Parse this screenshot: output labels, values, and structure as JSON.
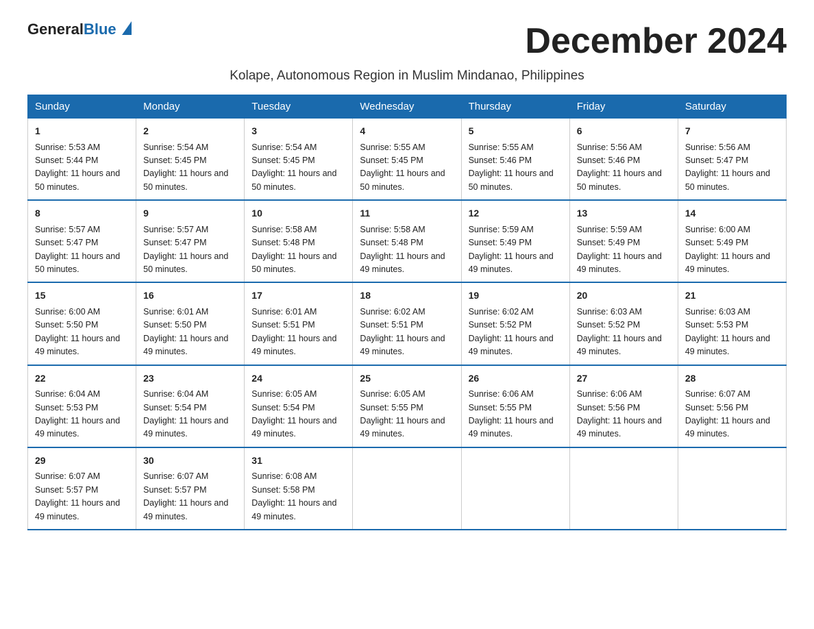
{
  "header": {
    "logo_general": "General",
    "logo_blue": "Blue",
    "month_title": "December 2024",
    "subtitle": "Kolape, Autonomous Region in Muslim Mindanao, Philippines"
  },
  "days_of_week": [
    "Sunday",
    "Monday",
    "Tuesday",
    "Wednesday",
    "Thursday",
    "Friday",
    "Saturday"
  ],
  "weeks": [
    [
      {
        "day": "1",
        "sunrise": "5:53 AM",
        "sunset": "5:44 PM",
        "daylight": "11 hours and 50 minutes."
      },
      {
        "day": "2",
        "sunrise": "5:54 AM",
        "sunset": "5:45 PM",
        "daylight": "11 hours and 50 minutes."
      },
      {
        "day": "3",
        "sunrise": "5:54 AM",
        "sunset": "5:45 PM",
        "daylight": "11 hours and 50 minutes."
      },
      {
        "day": "4",
        "sunrise": "5:55 AM",
        "sunset": "5:45 PM",
        "daylight": "11 hours and 50 minutes."
      },
      {
        "day": "5",
        "sunrise": "5:55 AM",
        "sunset": "5:46 PM",
        "daylight": "11 hours and 50 minutes."
      },
      {
        "day": "6",
        "sunrise": "5:56 AM",
        "sunset": "5:46 PM",
        "daylight": "11 hours and 50 minutes."
      },
      {
        "day": "7",
        "sunrise": "5:56 AM",
        "sunset": "5:47 PM",
        "daylight": "11 hours and 50 minutes."
      }
    ],
    [
      {
        "day": "8",
        "sunrise": "5:57 AM",
        "sunset": "5:47 PM",
        "daylight": "11 hours and 50 minutes."
      },
      {
        "day": "9",
        "sunrise": "5:57 AM",
        "sunset": "5:47 PM",
        "daylight": "11 hours and 50 minutes."
      },
      {
        "day": "10",
        "sunrise": "5:58 AM",
        "sunset": "5:48 PM",
        "daylight": "11 hours and 50 minutes."
      },
      {
        "day": "11",
        "sunrise": "5:58 AM",
        "sunset": "5:48 PM",
        "daylight": "11 hours and 49 minutes."
      },
      {
        "day": "12",
        "sunrise": "5:59 AM",
        "sunset": "5:49 PM",
        "daylight": "11 hours and 49 minutes."
      },
      {
        "day": "13",
        "sunrise": "5:59 AM",
        "sunset": "5:49 PM",
        "daylight": "11 hours and 49 minutes."
      },
      {
        "day": "14",
        "sunrise": "6:00 AM",
        "sunset": "5:49 PM",
        "daylight": "11 hours and 49 minutes."
      }
    ],
    [
      {
        "day": "15",
        "sunrise": "6:00 AM",
        "sunset": "5:50 PM",
        "daylight": "11 hours and 49 minutes."
      },
      {
        "day": "16",
        "sunrise": "6:01 AM",
        "sunset": "5:50 PM",
        "daylight": "11 hours and 49 minutes."
      },
      {
        "day": "17",
        "sunrise": "6:01 AM",
        "sunset": "5:51 PM",
        "daylight": "11 hours and 49 minutes."
      },
      {
        "day": "18",
        "sunrise": "6:02 AM",
        "sunset": "5:51 PM",
        "daylight": "11 hours and 49 minutes."
      },
      {
        "day": "19",
        "sunrise": "6:02 AM",
        "sunset": "5:52 PM",
        "daylight": "11 hours and 49 minutes."
      },
      {
        "day": "20",
        "sunrise": "6:03 AM",
        "sunset": "5:52 PM",
        "daylight": "11 hours and 49 minutes."
      },
      {
        "day": "21",
        "sunrise": "6:03 AM",
        "sunset": "5:53 PM",
        "daylight": "11 hours and 49 minutes."
      }
    ],
    [
      {
        "day": "22",
        "sunrise": "6:04 AM",
        "sunset": "5:53 PM",
        "daylight": "11 hours and 49 minutes."
      },
      {
        "day": "23",
        "sunrise": "6:04 AM",
        "sunset": "5:54 PM",
        "daylight": "11 hours and 49 minutes."
      },
      {
        "day": "24",
        "sunrise": "6:05 AM",
        "sunset": "5:54 PM",
        "daylight": "11 hours and 49 minutes."
      },
      {
        "day": "25",
        "sunrise": "6:05 AM",
        "sunset": "5:55 PM",
        "daylight": "11 hours and 49 minutes."
      },
      {
        "day": "26",
        "sunrise": "6:06 AM",
        "sunset": "5:55 PM",
        "daylight": "11 hours and 49 minutes."
      },
      {
        "day": "27",
        "sunrise": "6:06 AM",
        "sunset": "5:56 PM",
        "daylight": "11 hours and 49 minutes."
      },
      {
        "day": "28",
        "sunrise": "6:07 AM",
        "sunset": "5:56 PM",
        "daylight": "11 hours and 49 minutes."
      }
    ],
    [
      {
        "day": "29",
        "sunrise": "6:07 AM",
        "sunset": "5:57 PM",
        "daylight": "11 hours and 49 minutes."
      },
      {
        "day": "30",
        "sunrise": "6:07 AM",
        "sunset": "5:57 PM",
        "daylight": "11 hours and 49 minutes."
      },
      {
        "day": "31",
        "sunrise": "6:08 AM",
        "sunset": "5:58 PM",
        "daylight": "11 hours and 49 minutes."
      },
      null,
      null,
      null,
      null
    ]
  ]
}
